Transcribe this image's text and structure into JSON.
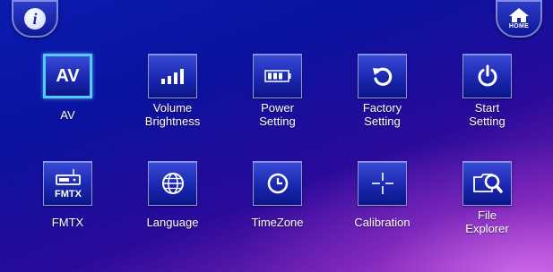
{
  "top_bar": {
    "info_button": {
      "icon": "info-icon"
    },
    "home_button": {
      "icon": "home-icon",
      "label": "HOME"
    }
  },
  "menu": {
    "row1": [
      {
        "label": "AV",
        "icon": "av-icon",
        "icon_text": "AV",
        "selected": true
      },
      {
        "label": "Volume\nBrightness",
        "icon": "volume-bars-icon"
      },
      {
        "label": "Power\nSetting",
        "icon": "battery-icon"
      },
      {
        "label": "Factory\nSetting",
        "icon": "reset-arrow-icon"
      },
      {
        "label": "Start\nSetting",
        "icon": "power-icon"
      }
    ],
    "row2": [
      {
        "label": "FMTX",
        "icon": "radio-icon",
        "icon_text": "FMTX"
      },
      {
        "label": "Language",
        "icon": "globe-icon"
      },
      {
        "label": "TimeZone",
        "icon": "clock-icon"
      },
      {
        "label": "Calibration",
        "icon": "crosshair-icon"
      },
      {
        "label": "File\nExplorer",
        "icon": "folder-search-icon"
      }
    ]
  },
  "colors": {
    "selection": "#55c8ff",
    "background_top": "#0b1bb0",
    "background_accent": "#b03ac8"
  }
}
